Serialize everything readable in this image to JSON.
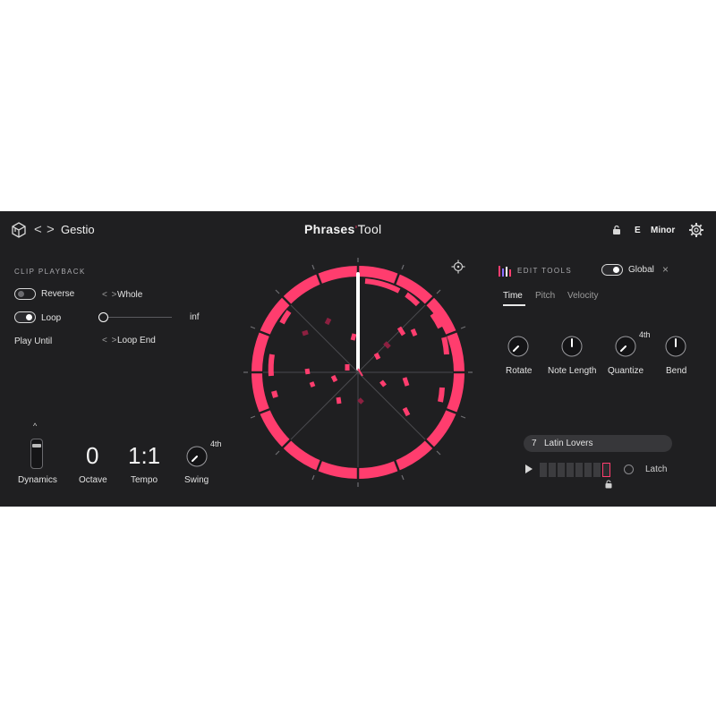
{
  "header": {
    "preset_name": "Gestio",
    "brand_bold": "Phrases",
    "brand_light": "Tool",
    "key_root": "E",
    "key_scale": "Minor",
    "back_label": "<",
    "forward_label": ">"
  },
  "clip_playback": {
    "title": "CLIP PLAYBACK",
    "reverse_label": "Reverse",
    "reverse_on": false,
    "loop_label": "Loop",
    "loop_on": true,
    "play_until_label": "Play Until",
    "whole_label": "Whole",
    "inf_label": "inf",
    "loop_end_label": "Loop End",
    "chevrons": "< >"
  },
  "controls": {
    "dynamics_label": "Dynamics",
    "octave_value": "0",
    "octave_label": "Octave",
    "tempo_value": "1:1",
    "tempo_label": "Tempo",
    "swing_label": "Swing",
    "swing_value": "4th"
  },
  "edit_tools": {
    "title": "EDIT TOOLS",
    "global_label": "Global",
    "global_on": true,
    "close_label": "×",
    "tabs": [
      {
        "label": "Time",
        "active": true
      },
      {
        "label": "Pitch",
        "active": false
      },
      {
        "label": "Velocity",
        "active": false
      }
    ],
    "knobs": [
      {
        "label": "Rotate"
      },
      {
        "label": "Note Length"
      },
      {
        "label": "Quantize",
        "value": "4th"
      },
      {
        "label": "Bend"
      }
    ]
  },
  "phrase": {
    "number": "7",
    "name": "Latin Lovers",
    "latch_label": "Latch",
    "segments": 8,
    "active_segment": 7
  },
  "colors": {
    "accent": "#ff3d6e",
    "panel": "#1f1f21",
    "dark_accent": "#8c2040"
  }
}
